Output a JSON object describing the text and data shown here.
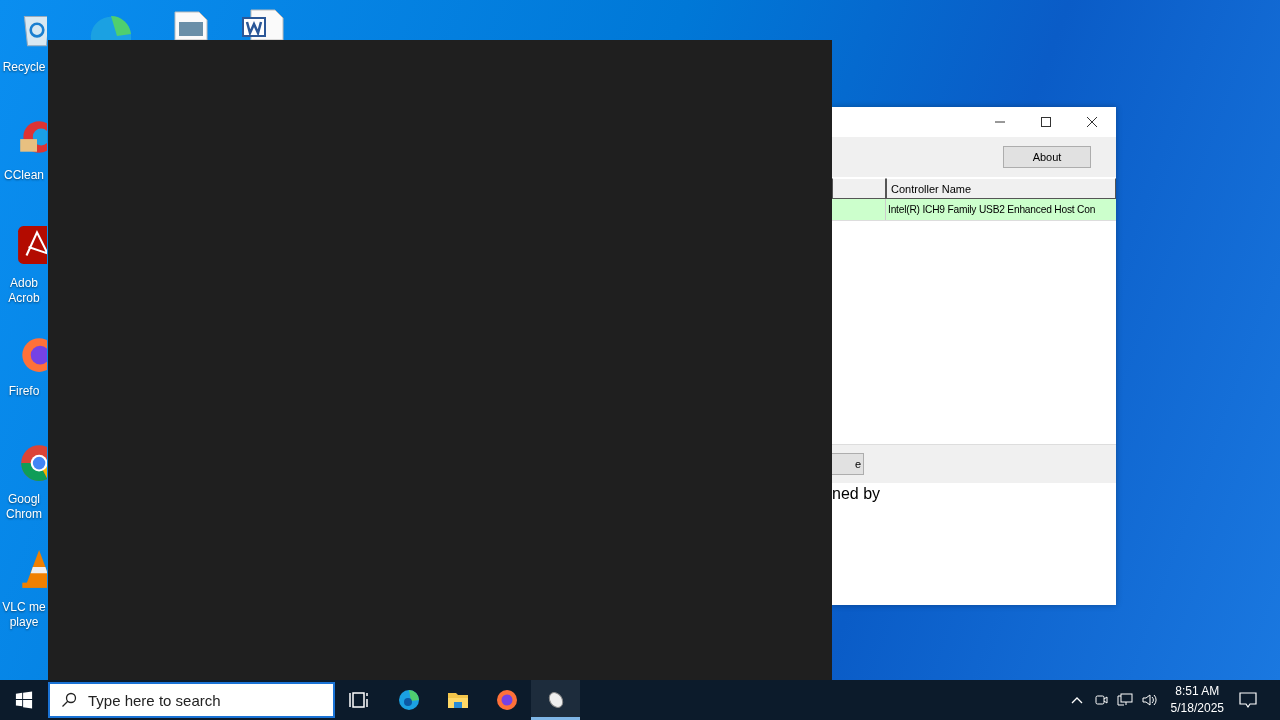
{
  "desktop_icons": [
    {
      "kind": "recycle",
      "lines": [
        "Recycle"
      ]
    },
    {
      "kind": "ccleaner",
      "lines": [
        "CClean"
      ]
    },
    {
      "kind": "acrobat",
      "lines": [
        "Adob",
        "Acrob"
      ]
    },
    {
      "kind": "firefox",
      "lines": [
        "Firefo"
      ]
    },
    {
      "kind": "chrome",
      "lines": [
        "Googl",
        "Chrom"
      ]
    },
    {
      "kind": "vlc",
      "lines": [
        "VLC me",
        "playe"
      ]
    }
  ],
  "top_icons": [
    {
      "kind": "edge"
    },
    {
      "kind": "image_file"
    },
    {
      "kind": "word_file"
    }
  ],
  "app_window": {
    "about_button": "About",
    "column_header": "Controller Name",
    "rows": [
      {
        "controller_name": "Intel(R) ICH9 Family USB2 Enhanced Host Con",
        "selected": true
      }
    ],
    "bottom_button": "e",
    "footer_text": "ned by"
  },
  "taskbar": {
    "search": {
      "placeholder": "Type here to search"
    },
    "apps": [
      {
        "kind": "task_view",
        "selected": false
      },
      {
        "kind": "edge",
        "selected": false
      },
      {
        "kind": "explorer",
        "selected": false
      },
      {
        "kind": "firefox",
        "selected": false
      },
      {
        "kind": "mouse",
        "selected": true
      }
    ],
    "time": "8:51 AM",
    "date": "5/18/2025"
  }
}
